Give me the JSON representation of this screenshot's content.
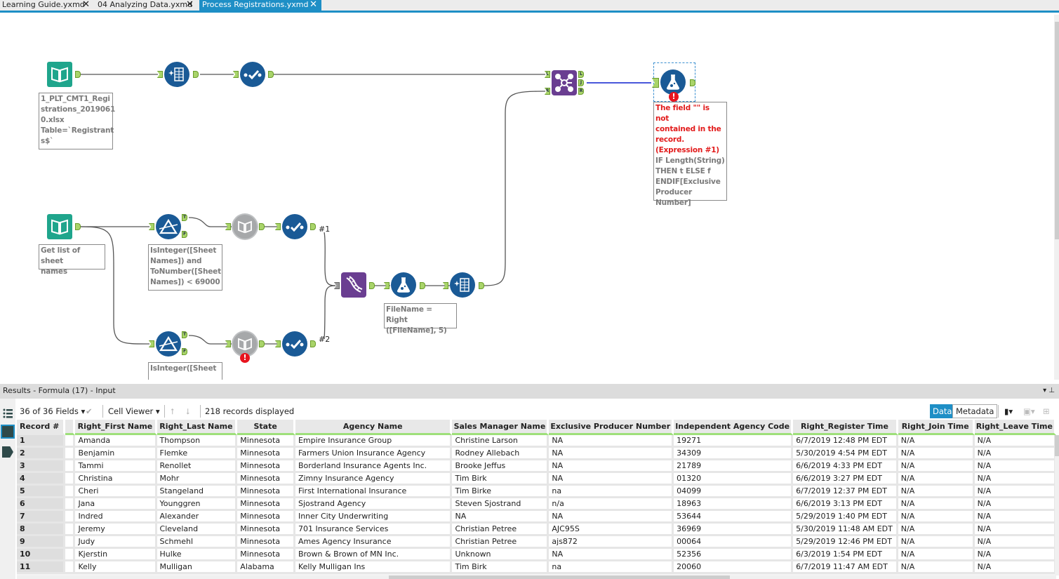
{
  "tabs": [
    {
      "label": "Learning Guide.yxmd",
      "active": false
    },
    {
      "label": "04 Analyzing Data.yxmd",
      "active": false
    },
    {
      "label": "Process Registrations.yxmd",
      "active": true
    }
  ],
  "tab_close_glyph": "✕",
  "canvas": {
    "tools": {
      "input1": {
        "icon": "input-data-book-icon",
        "annotation": "1_PLT_CMT1_Registrations_20190610.xlsx Table=`Registrants$`",
        "annotation_lines": [
          "1_PLT_CMT1_Regi",
          "strations_2019061",
          "0.xlsx",
          "Table=`Registrant",
          "s$`"
        ]
      },
      "input2": {
        "icon": "input-data-book-icon",
        "annotation_lines": [
          "Get list of sheet",
          "names"
        ]
      },
      "filter1": {
        "annotation_lines": [
          "IsInteger([Sheet",
          "Names]) and",
          "ToNumber([Sheet",
          "Names]) < 69000"
        ],
        "anchors": [
          "T",
          "F"
        ]
      },
      "filter2": {
        "annotation_lines": [
          "IsInteger([Sheet"
        ],
        "anchors": [
          "T",
          "F"
        ]
      },
      "formula_mid": {
        "annotation_lines": [
          "FileName = Right",
          "([FileName], 5)"
        ]
      },
      "join": {
        "anchors_in": [
          "L",
          "R"
        ],
        "anchors_out": [
          "L",
          "J",
          "R"
        ]
      },
      "formula_err": {
        "error_lines": [
          "The field \"\" is not",
          "contained in the",
          "record.",
          "(Expression #1)"
        ],
        "expr_lines": [
          "IF Length(String)",
          "THEN t ELSE f",
          "ENDIF[Exclusive",
          "Producer",
          "Number]"
        ]
      }
    },
    "wire_labels": [
      "#1",
      "#2"
    ],
    "error_glyph": "!"
  },
  "results": {
    "title": "Results - Formula (17) - Input",
    "fields_select": "36 of 36 Fields",
    "cell_viewer": "Cell Viewer",
    "records_displayed": "218 records displayed",
    "data_tab": "Data",
    "metadata_tab": "Metadata",
    "columns": [
      "Record #",
      "",
      "Right_First Name",
      "Right_Last Name",
      "State",
      "Agency Name",
      "Sales Manager Name",
      "Exclusive Producer Number",
      "Independent Agency Code",
      "Right_Register Time",
      "Right_Join Time",
      "Right_Leave Time"
    ],
    "rows": [
      [
        "1",
        "",
        "Amanda",
        "Thompson",
        "Minnesota",
        "Empire Insurance Group",
        "Christine Larson",
        "NA",
        "19271",
        "6/7/2019 12:48 PM EDT",
        "N/A",
        "N/A"
      ],
      [
        "2",
        "",
        "Benjamin",
        "Flemke",
        "Minnesota",
        "Farmers Union Insurance Agency",
        "Rodney Allebach",
        "NA",
        "34309",
        "5/30/2019 4:54 PM EDT",
        "N/A",
        "N/A"
      ],
      [
        "3",
        "",
        "Tammi",
        "Renollet",
        "Minnesota",
        "Borderland Insurance Agents Inc.",
        "Brooke Jeffus",
        "NA",
        "21789",
        "6/6/2019 4:33 PM EDT",
        "N/A",
        "N/A"
      ],
      [
        "4",
        "",
        "Christina",
        "Mohr",
        "Minnesota",
        "Zimny Insurance Agency",
        "Tim Birk",
        "NA",
        "01320",
        "6/6/2019 3:27 PM EDT",
        "N/A",
        "N/A"
      ],
      [
        "5",
        "",
        "Cheri",
        "Stangeland",
        "Minnesota",
        "First International Insurance",
        "Tim Birke",
        "na",
        "04099",
        "6/7/2019 12:37 PM EDT",
        "N/A",
        "N/A"
      ],
      [
        "6",
        "",
        "Jana",
        "Younggren",
        "Minnesota",
        "Sjostrand Agency",
        "Steven Sjostrand",
        "n/a",
        "18963",
        "6/6/2019 3:13 PM EDT",
        "N/A",
        "N/A"
      ],
      [
        "7",
        "",
        "Indred",
        "Alexander",
        "Minnesota",
        "Inner City Underwriting",
        "NA",
        "NA",
        "53644",
        "5/29/2019 1:40 PM EDT",
        "N/A",
        "N/A"
      ],
      [
        "8",
        "",
        "Jeremy",
        "Cleveland",
        "Minnesota",
        "701 Insurance Services",
        "Christian Petree",
        "AJC95S",
        "36969",
        "5/30/2019 11:48 AM EDT",
        "N/A",
        "N/A"
      ],
      [
        "9",
        "",
        "Judy",
        "Schmehl",
        "Minnesota",
        "Ames Agency Insurance",
        "Christian Petree",
        "ajs872",
        "00064",
        "5/29/2019 12:46 PM EDT",
        "N/A",
        "N/A"
      ],
      [
        "10",
        "",
        "Kjerstin",
        "Hulke",
        "Minnesota",
        "Brown & Brown of MN Inc.",
        "Unknown",
        "NA",
        "52356",
        "6/3/2019 1:54 PM EDT",
        "N/A",
        "N/A"
      ],
      [
        "11",
        "",
        "Kelly",
        "Mulligan",
        "Alabama",
        "Kelly Mulligan Ins",
        "Tim Birk",
        "na",
        "20060",
        "6/7/2019 11:47 AM EDT",
        "N/A",
        "N/A"
      ]
    ]
  }
}
